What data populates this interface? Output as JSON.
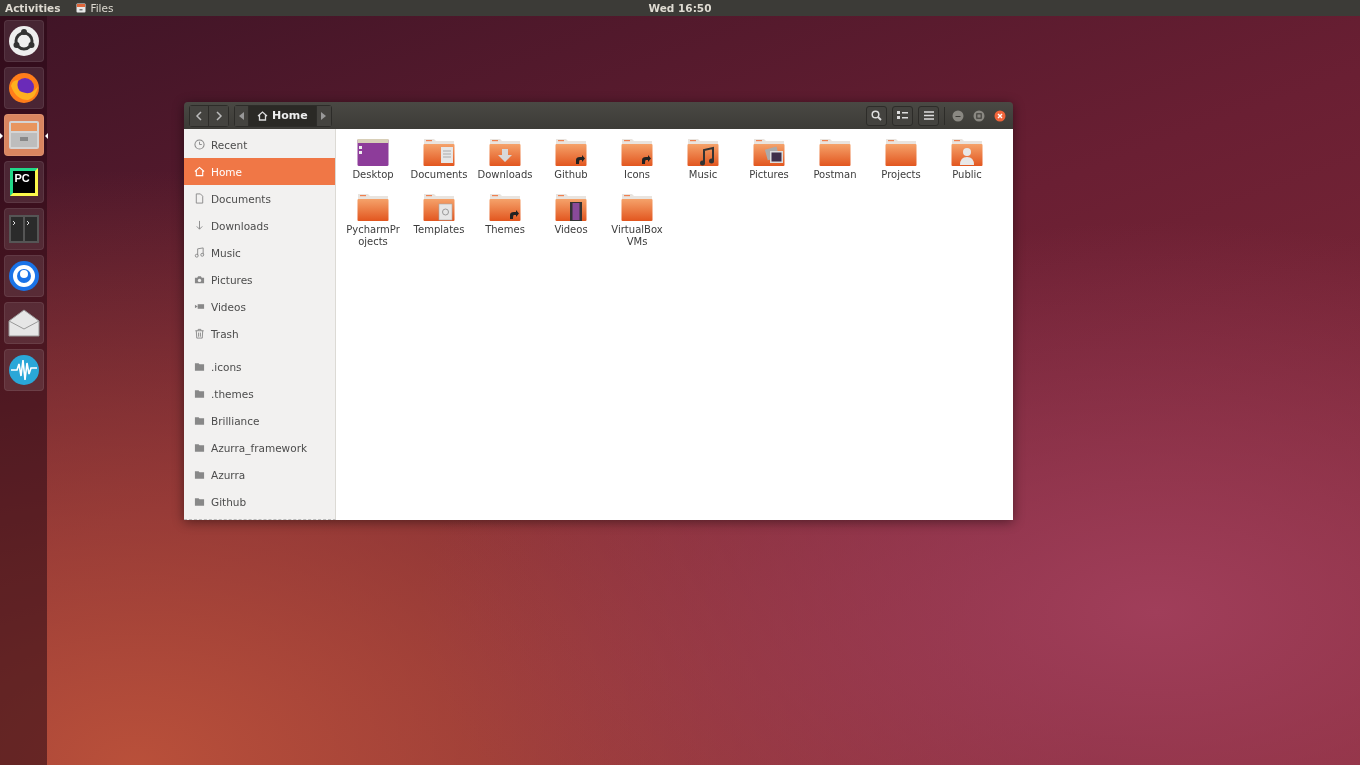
{
  "top_bar": {
    "activities": "Activities",
    "app_menu": "Files",
    "clock": "Wed 16:50"
  },
  "dock": [
    {
      "kind": "ring",
      "active": false
    },
    {
      "kind": "browser",
      "active": false
    },
    {
      "kind": "files",
      "active": true
    },
    {
      "kind": "pc",
      "text": "PC",
      "active": false
    },
    {
      "kind": "terminal",
      "active": false
    },
    {
      "kind": "dial",
      "active": false
    },
    {
      "kind": "mail",
      "active": false
    },
    {
      "kind": "wave",
      "active": false
    }
  ],
  "window": {
    "path": [
      {
        "label": "Home",
        "selected": true
      }
    ]
  },
  "sidebar": {
    "places": [
      {
        "label": "Recent",
        "kind": "recent",
        "selected": false
      },
      {
        "label": "Home",
        "kind": "home",
        "selected": true
      },
      {
        "label": "Documents",
        "kind": "document",
        "selected": false
      },
      {
        "label": "Downloads",
        "kind": "download",
        "selected": false
      },
      {
        "label": "Music",
        "kind": "music",
        "selected": false
      },
      {
        "label": "Pictures",
        "kind": "camera",
        "selected": false
      },
      {
        "label": "Videos",
        "kind": "video",
        "selected": false
      },
      {
        "label": "Trash",
        "kind": "trash",
        "selected": false
      }
    ],
    "bookmarks": [
      {
        "label": ".icons",
        "selected": false
      },
      {
        "label": ".themes",
        "selected": false
      },
      {
        "label": "Brilliance",
        "selected": false
      },
      {
        "label": "Azurra_framework",
        "selected": false
      },
      {
        "label": "Azurra",
        "selected": false
      },
      {
        "label": "Github",
        "selected": false
      }
    ]
  },
  "files": [
    {
      "name": "Desktop",
      "kind": "desktop"
    },
    {
      "name": "Documents",
      "kind": "documents"
    },
    {
      "name": "Downloads",
      "kind": "downloads"
    },
    {
      "name": "Github",
      "kind": "link"
    },
    {
      "name": "Icons",
      "kind": "link"
    },
    {
      "name": "Music",
      "kind": "music"
    },
    {
      "name": "Pictures",
      "kind": "pictures"
    },
    {
      "name": "Postman",
      "kind": "plain"
    },
    {
      "name": "Projects",
      "kind": "plain"
    },
    {
      "name": "Public",
      "kind": "public"
    },
    {
      "name": "PycharmPr ojects",
      "kind": "plain"
    },
    {
      "name": "Templates",
      "kind": "templates"
    },
    {
      "name": "Themes",
      "kind": "link"
    },
    {
      "name": "Videos",
      "kind": "videos"
    },
    {
      "name": "VirtualBox VMs",
      "kind": "plain"
    }
  ]
}
